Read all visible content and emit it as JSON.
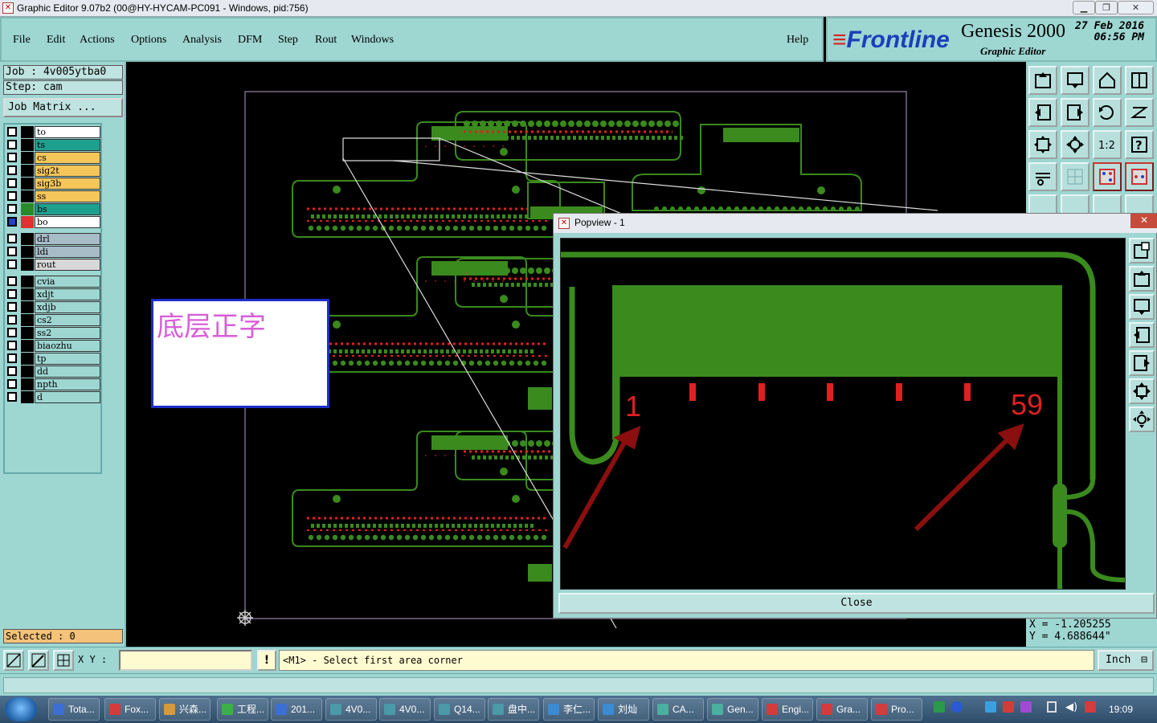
{
  "window": {
    "title": "Graphic Editor 9.07b2 (00@HY-HYCAM-PC091 - Windows, pid:756)",
    "min_icon": "minimize-icon",
    "max_icon": "maximize-icon",
    "close_icon": "close-icon"
  },
  "menu": {
    "items": [
      "File",
      "Edit",
      "Actions",
      "Options",
      "Analysis",
      "DFM",
      "Step",
      "Rout",
      "Windows"
    ],
    "help": "Help"
  },
  "brand": {
    "logo": "Frontline",
    "product": "Genesis 2000",
    "subtitle": "Graphic Editor",
    "date": "27 Feb 2016",
    "time": "06:56 PM",
    "logo_color": "#1a3fb8"
  },
  "job": {
    "job_label": "Job  :  4v005ytba0",
    "step_label": "Step:  cam",
    "matrix_button": "Job Matrix ..."
  },
  "layers": {
    "group1": [
      {
        "name": "to",
        "color": "#ffffff"
      },
      {
        "name": "ts",
        "color": "#1ea08f"
      },
      {
        "name": "cs",
        "color": "#f5c75a"
      },
      {
        "name": "sig2t",
        "color": "#f5c75a"
      },
      {
        "name": "sig3b",
        "color": "#f5c75a"
      },
      {
        "name": "ss",
        "color": "#f5c75a"
      },
      {
        "name": "bs",
        "color": "#1ea08f"
      },
      {
        "name": "bo",
        "color": "#ffffff"
      }
    ],
    "group2": [
      {
        "name": "drl",
        "color": "#a8bcc8"
      },
      {
        "name": "ldi",
        "color": "#a8bcc8"
      },
      {
        "name": "rout",
        "color": "#d8d8d8"
      }
    ],
    "group3": [
      {
        "name": "cvia",
        "color": "#9ed6d2"
      },
      {
        "name": "xdjt",
        "color": "#9ed6d2"
      },
      {
        "name": "xdjb",
        "color": "#9ed6d2"
      },
      {
        "name": "cs2",
        "color": "#9ed6d2"
      },
      {
        "name": "ss2",
        "color": "#9ed6d2"
      },
      {
        "name": "biaozhu",
        "color": "#9ed6d2"
      },
      {
        "name": "tp",
        "color": "#9ed6d2"
      },
      {
        "name": "dd",
        "color": "#9ed6d2"
      },
      {
        "name": "npth",
        "color": "#9ed6d2"
      },
      {
        "name": "d",
        "color": "#9ed6d2"
      }
    ],
    "selected": "Selected : 0"
  },
  "canvas": {
    "annotation_text": "底层正字",
    "board_color": "#3a8a1e",
    "text_color": "#e02020"
  },
  "popview": {
    "title": "Popview - 1",
    "label_left": "1",
    "label_right": "59",
    "close_button": "Close"
  },
  "coords": {
    "x": "X = -1.205255",
    "y": "Y = 4.688644\""
  },
  "status": {
    "xy_label": "X Y :",
    "xy_value": "",
    "exclaim": "!",
    "prompt": "<M1> - Select first area corner",
    "units": "Inch"
  },
  "taskbar": {
    "items": [
      {
        "label": "Tota...",
        "color": "#3b6fd4"
      },
      {
        "label": "Fox...",
        "color": "#d43b3b"
      },
      {
        "label": "兴森...",
        "color": "#d49a3b"
      },
      {
        "label": "工程...",
        "color": "#3bb04a"
      },
      {
        "label": "201...",
        "color": "#3b6fd4"
      },
      {
        "label": "4V0...",
        "color": "#4a9aa8"
      },
      {
        "label": "4V0...",
        "color": "#4a9aa8"
      },
      {
        "label": "Q14...",
        "color": "#4a9aa8"
      },
      {
        "label": "盘中...",
        "color": "#4a9aa8"
      },
      {
        "label": "李仁...",
        "color": "#3b8ad4"
      },
      {
        "label": "刘灿",
        "color": "#3b8ad4"
      },
      {
        "label": "CA...",
        "color": "#4ab0a0"
      },
      {
        "label": "Gen...",
        "color": "#4ab0a0"
      },
      {
        "label": "Engi...",
        "color": "#d43b3b"
      },
      {
        "label": "Gra...",
        "color": "#d43b3b"
      },
      {
        "label": "Pro...",
        "color": "#d43b3b"
      }
    ],
    "clock": "19:09"
  }
}
